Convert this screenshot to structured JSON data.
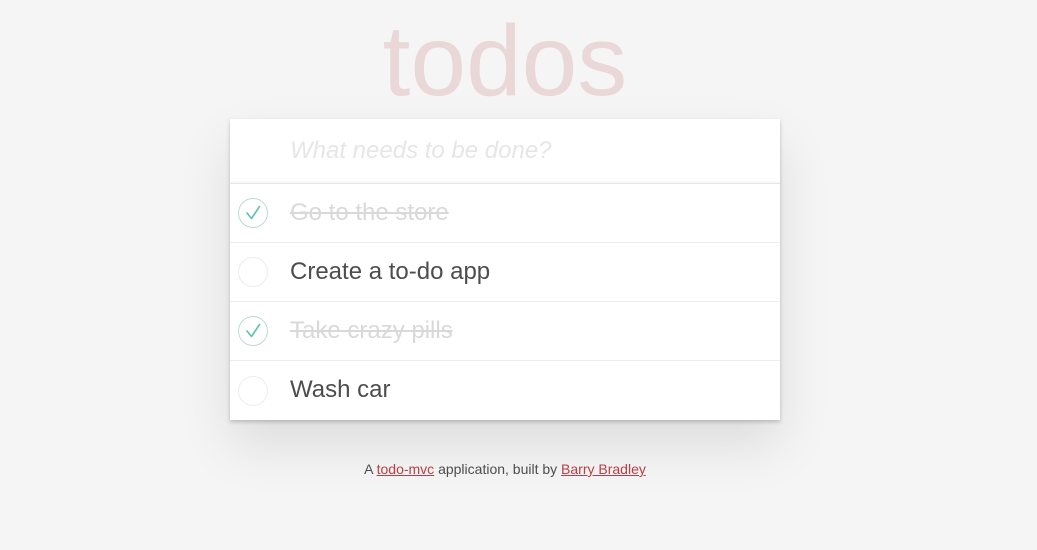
{
  "app": {
    "title": "todos"
  },
  "new_todo": {
    "placeholder": "What needs to be done?",
    "value": ""
  },
  "todos": [
    {
      "label": "Go to the store",
      "completed": true
    },
    {
      "label": "Create a to-do app",
      "completed": false
    },
    {
      "label": "Take crazy pills",
      "completed": true
    },
    {
      "label": "Wash car",
      "completed": false
    }
  ],
  "footer": {
    "prefix": "A",
    "link1_text": "todo-mvc",
    "middle": "application, built by",
    "link2_text": "Barry Bradley"
  },
  "colors": {
    "background": "#f5f5f5",
    "title": "#eaddde",
    "check": "#5dc2af",
    "completed_text": "#d9d9d9",
    "link": "#b83f45"
  }
}
